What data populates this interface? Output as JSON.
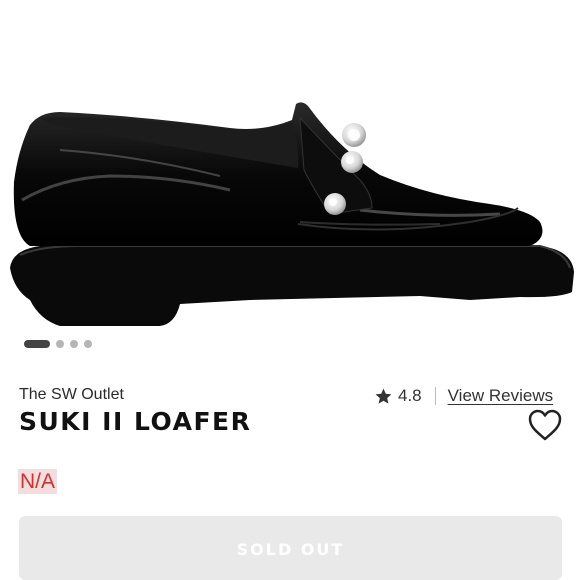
{
  "carousel": {
    "slide_count": 4,
    "active_index": 0
  },
  "product": {
    "brand": "The SW Outlet",
    "name": "SUKI II LOAFER",
    "rating": "4.8",
    "reviews_link": "View Reviews",
    "price": "N/A"
  },
  "actions": {
    "sold_out_label": "SOLD OUT"
  },
  "icons": {
    "rating": "star-icon",
    "wishlist": "heart-outline-icon"
  },
  "colors": {
    "price_text": "#d32f2f",
    "price_bg": "#f3dede",
    "button_bg": "#e9e9e9"
  }
}
